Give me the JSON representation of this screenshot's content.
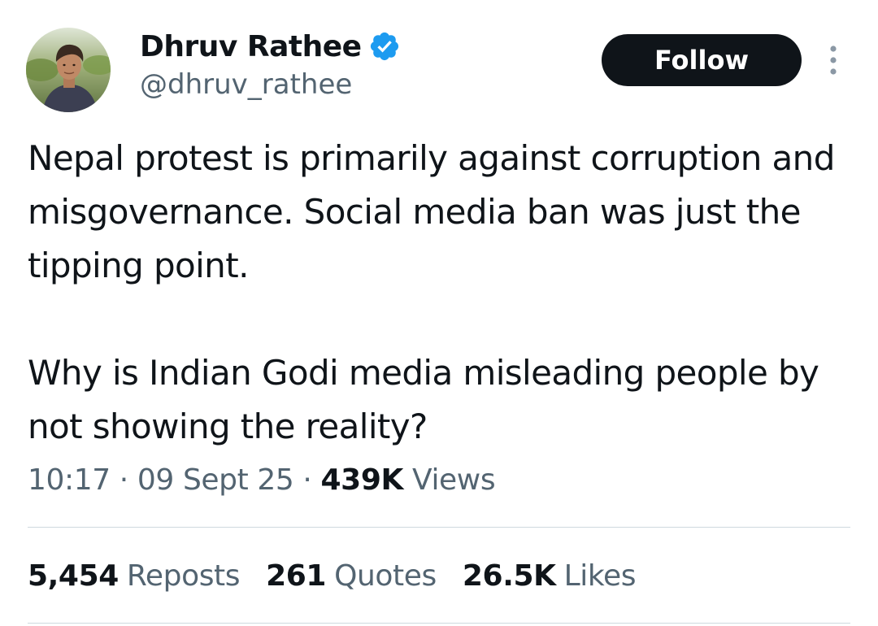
{
  "author": {
    "display_name": "Dhruv Rathee",
    "handle": "@dhruv_rathee",
    "verified_color": "#1d9bf0"
  },
  "follow_label": "Follow",
  "tweet": {
    "paragraphs": [
      "Nepal protest is primarily against corruption and misgovernance. Social media ban was just the tipping point.",
      "Why is Indian Godi media misleading people by not showing the reality?"
    ]
  },
  "meta": {
    "time": "10:17",
    "separator": "·",
    "date": "09 Sept 25",
    "views_count": "439K",
    "views_label": "Views"
  },
  "stats": {
    "reposts_count": "5,454",
    "reposts_label": "Reposts",
    "quotes_count": "261",
    "quotes_label": "Quotes",
    "likes_count": "26.5K",
    "likes_label": "Likes"
  },
  "icons": {
    "verified": "verified-badge-icon",
    "more": "more-options-icon"
  },
  "colors": {
    "primary_text": "#0f1419",
    "secondary_text": "#536471",
    "button_bg": "#0f1419",
    "divider": "#cfd9de"
  }
}
